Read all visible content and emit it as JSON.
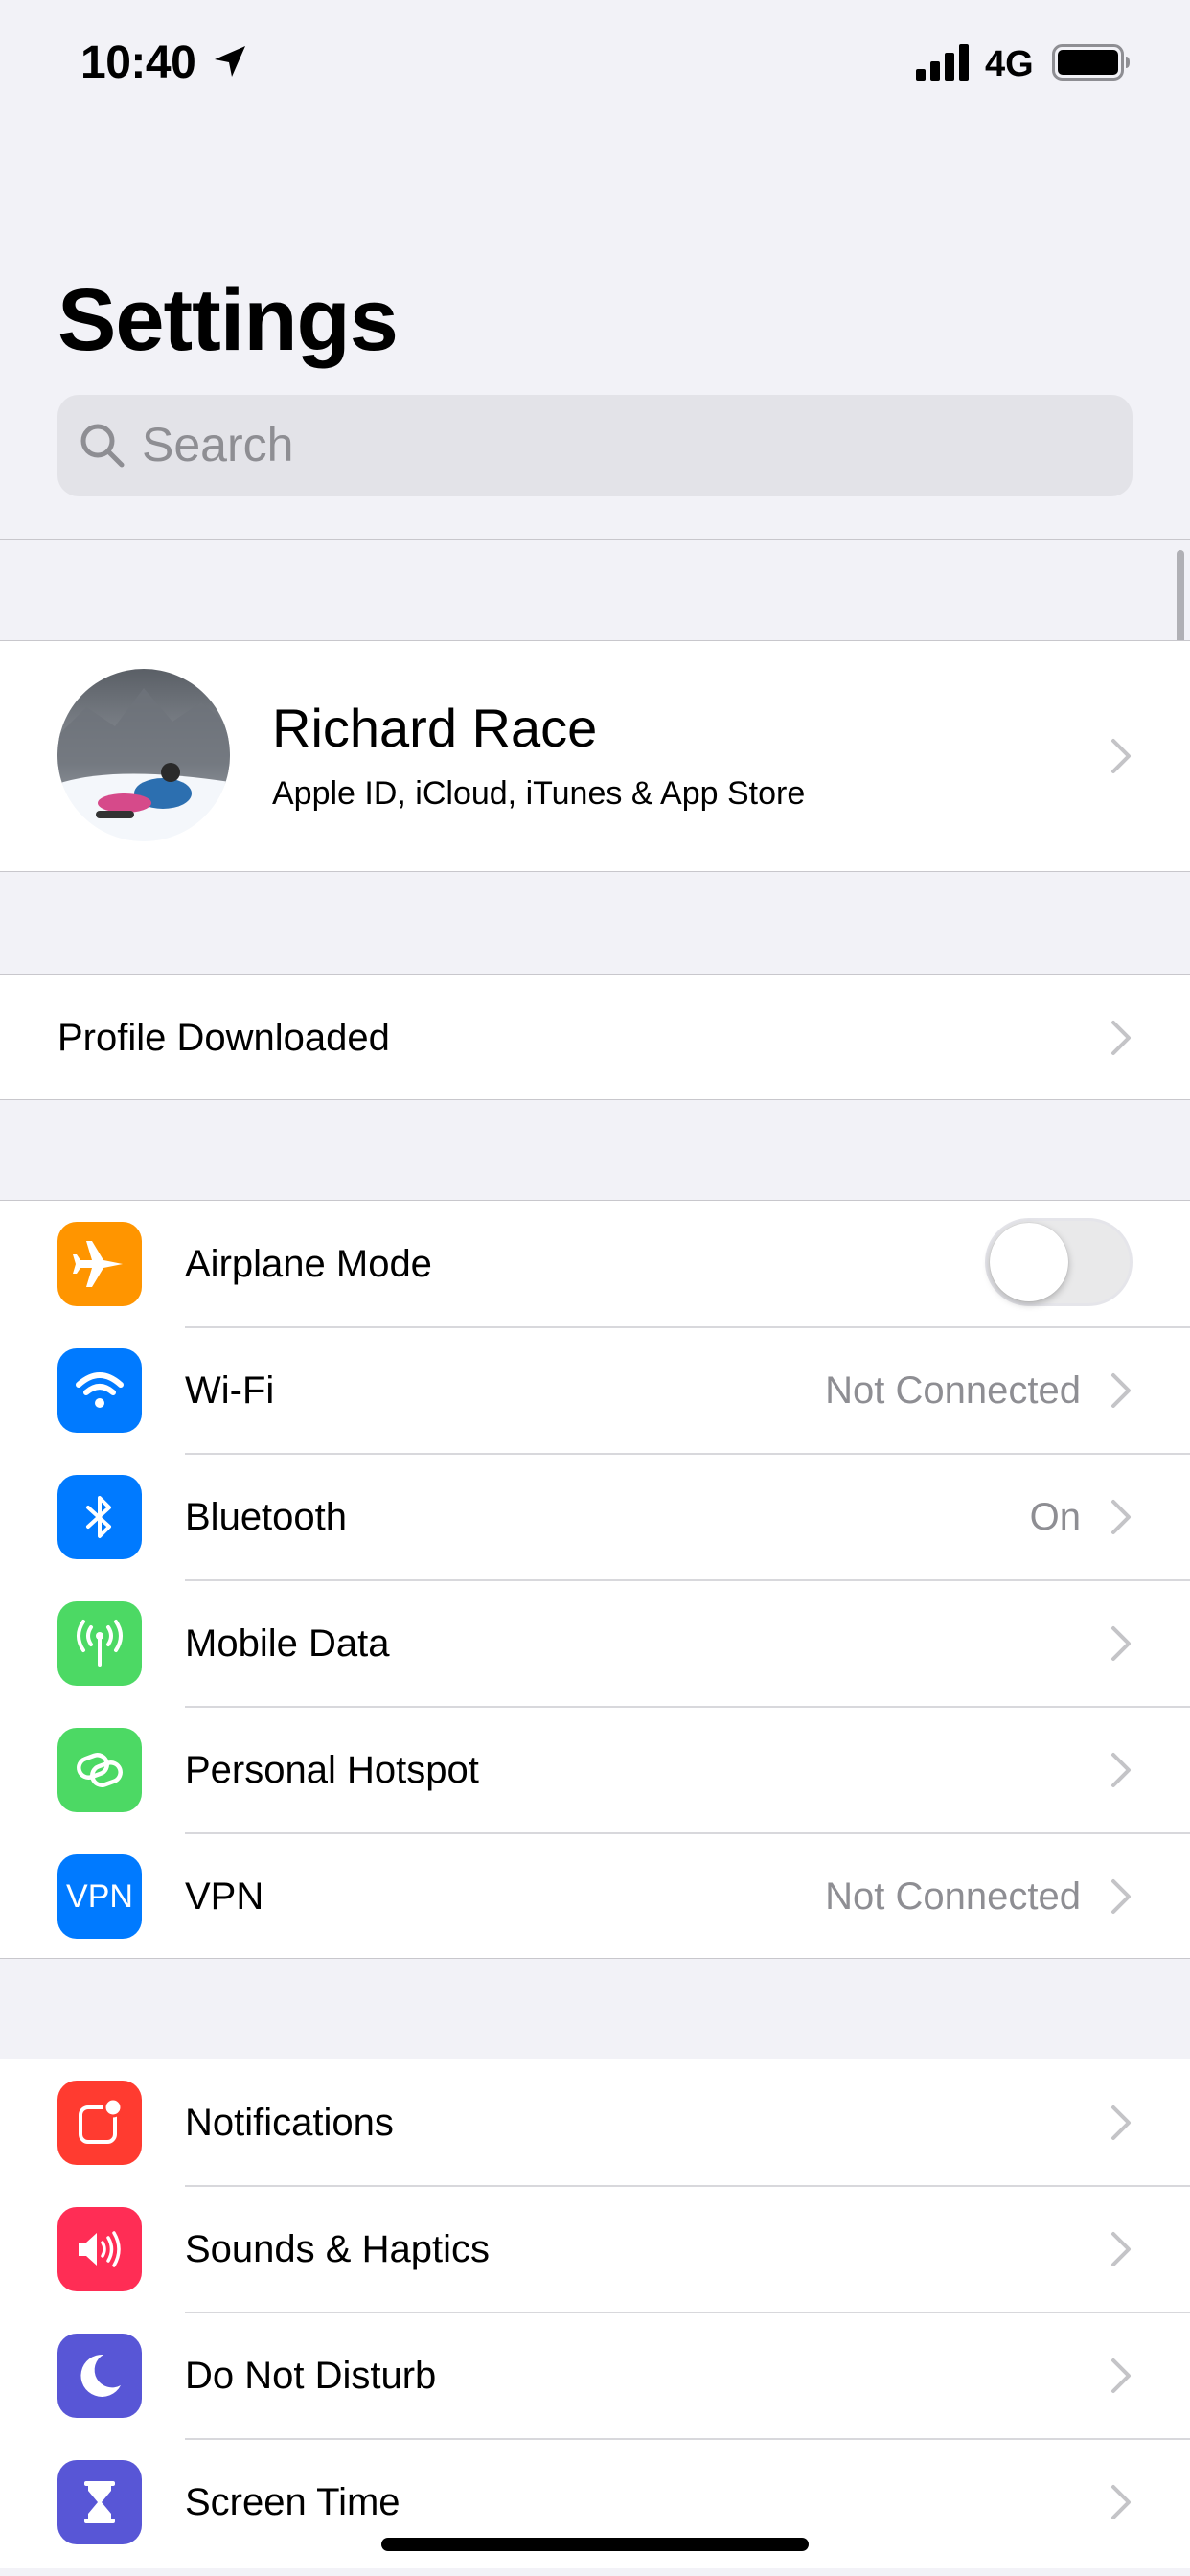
{
  "status_bar": {
    "time": "10:40",
    "network": "4G"
  },
  "title": "Settings",
  "search": {
    "placeholder": "Search"
  },
  "profile": {
    "name": "Richard Race",
    "subtitle": "Apple ID, iCloud, iTunes & App Store"
  },
  "profile_downloaded": {
    "label": "Profile Downloaded"
  },
  "connectivity": [
    {
      "label": "Airplane Mode",
      "icon": "airplane-icon",
      "color": "#ff9500",
      "toggle_on": false
    },
    {
      "label": "Wi-Fi",
      "icon": "wifi-icon",
      "color": "#007aff",
      "value": "Not Connected"
    },
    {
      "label": "Bluetooth",
      "icon": "bluetooth-icon",
      "color": "#007aff",
      "value": "On"
    },
    {
      "label": "Mobile Data",
      "icon": "antenna-icon",
      "color": "#4cd964"
    },
    {
      "label": "Personal Hotspot",
      "icon": "hotspot-icon",
      "color": "#4cd964"
    },
    {
      "label": "VPN",
      "icon": "vpn-icon",
      "icon_text": "VPN",
      "color": "#007aff",
      "value": "Not Connected"
    }
  ],
  "general": [
    {
      "label": "Notifications",
      "icon": "notifications-icon",
      "color": "#ff3b30"
    },
    {
      "label": "Sounds & Haptics",
      "icon": "speaker-icon",
      "color": "#ff2d55"
    },
    {
      "label": "Do Not Disturb",
      "icon": "moon-icon",
      "color": "#5856d6"
    },
    {
      "label": "Screen Time",
      "icon": "hourglass-icon",
      "color": "#5856d6"
    }
  ]
}
